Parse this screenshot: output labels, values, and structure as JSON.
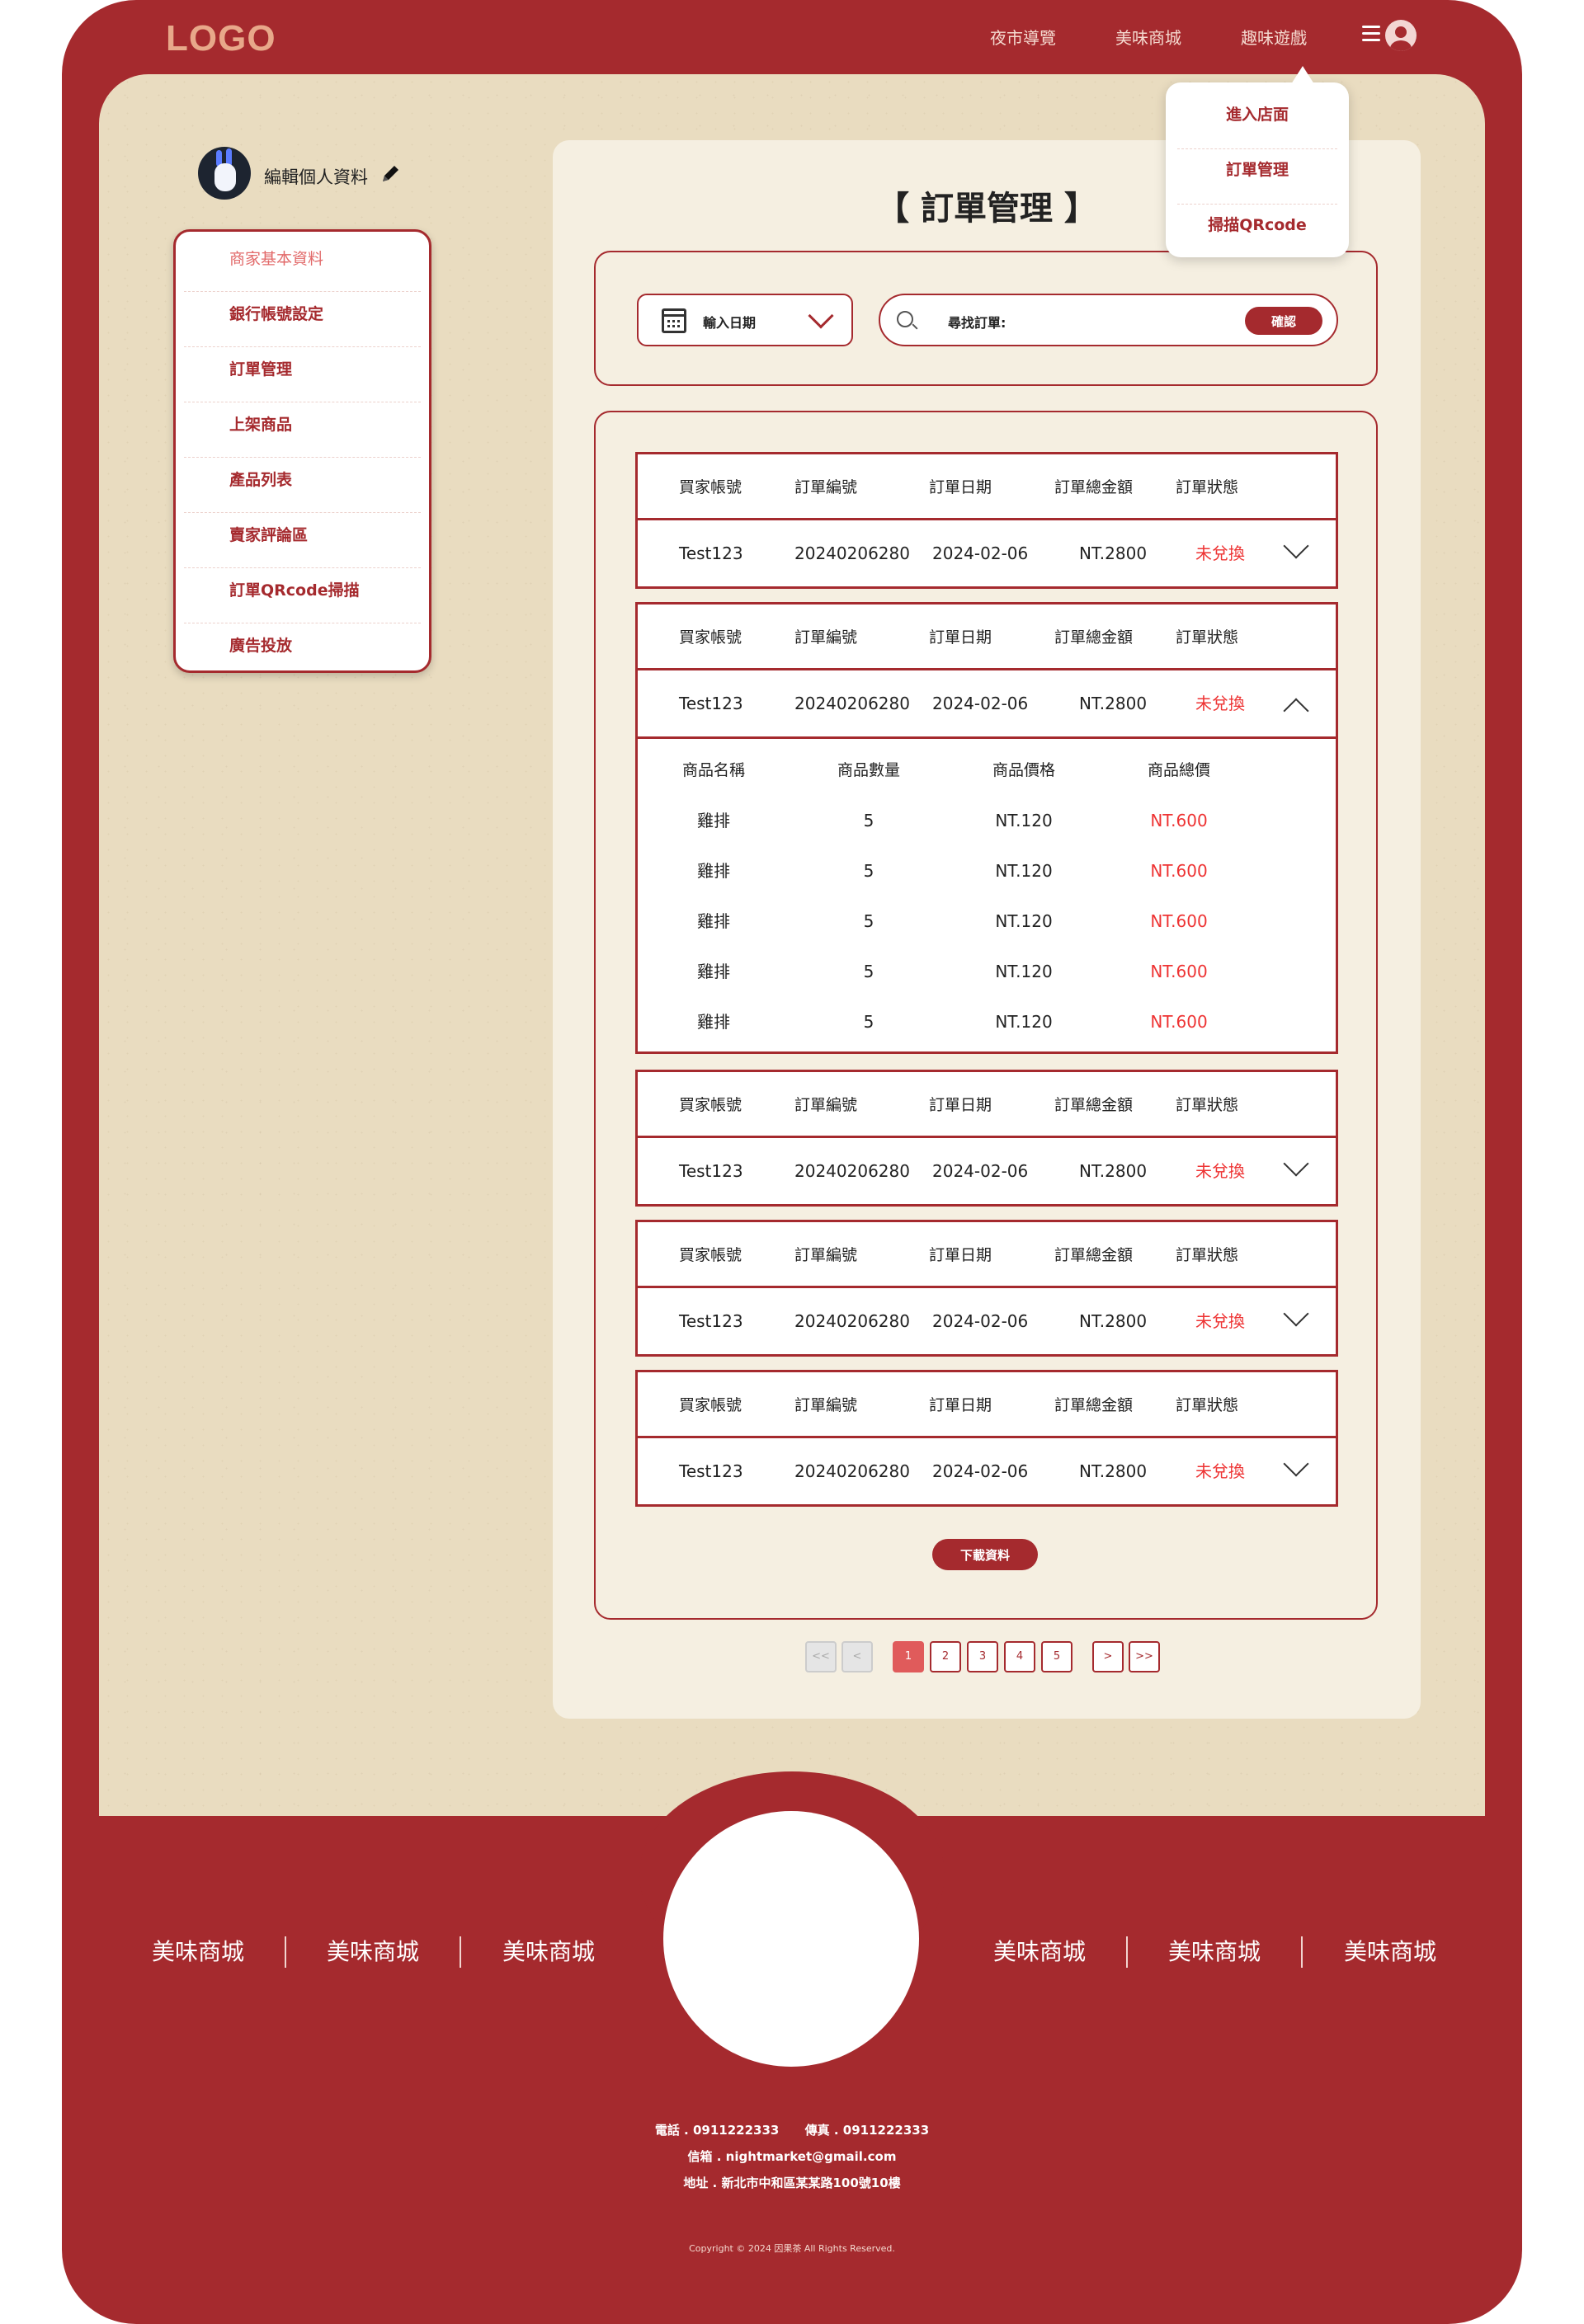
{
  "header": {
    "logo": "LOGO",
    "nav": [
      "夜市導覽",
      "美味商城",
      "趣味遊戲"
    ]
  },
  "dropdown": [
    "進入店面",
    "訂單管理",
    "掃描QRcode"
  ],
  "profile": {
    "edit_label": "編輯個人資料"
  },
  "sidebar": [
    "商家基本資料",
    "銀行帳號設定",
    "訂單管理",
    "上架商品",
    "產品列表",
    "賣家評論區",
    "訂單QRcode掃描",
    "廣告投放"
  ],
  "main": {
    "title": "【 訂單管理 】",
    "date_label": "輸入日期",
    "search_label": "尋找訂單:",
    "search_button": "確認",
    "order_headers": [
      "買家帳號",
      "訂單編號",
      "訂單日期",
      "訂單總金額",
      "訂單狀態"
    ],
    "orders": [
      {
        "account": "Test123",
        "number": "20240206280",
        "date": "2024-02-06",
        "total": "NT.2800",
        "status": "未兌換"
      },
      {
        "account": "Test123",
        "number": "20240206280",
        "date": "2024-02-06",
        "total": "NT.2800",
        "status": "未兌換"
      },
      {
        "account": "Test123",
        "number": "20240206280",
        "date": "2024-02-06",
        "total": "NT.2800",
        "status": "未兌換"
      },
      {
        "account": "Test123",
        "number": "20240206280",
        "date": "2024-02-06",
        "total": "NT.2800",
        "status": "未兌換"
      },
      {
        "account": "Test123",
        "number": "20240206280",
        "date": "2024-02-06",
        "total": "NT.2800",
        "status": "未兌換"
      }
    ],
    "item_headers": [
      "商品名稱",
      "商品數量",
      "商品價格",
      "商品總價"
    ],
    "items": [
      {
        "name": "雞排",
        "qty": "5",
        "price": "NT.120",
        "total": "NT.600"
      },
      {
        "name": "雞排",
        "qty": "5",
        "price": "NT.120",
        "total": "NT.600"
      },
      {
        "name": "雞排",
        "qty": "5",
        "price": "NT.120",
        "total": "NT.600"
      },
      {
        "name": "雞排",
        "qty": "5",
        "price": "NT.120",
        "total": "NT.600"
      },
      {
        "name": "雞排",
        "qty": "5",
        "price": "NT.120",
        "total": "NT.600"
      }
    ],
    "download": "下載資料"
  },
  "pagination": {
    "first": "<<",
    "prev": "<",
    "pages": [
      "1",
      "2",
      "3",
      "4",
      "5"
    ],
    "next": ">",
    "last": ">>",
    "current": "1"
  },
  "footer": {
    "links": [
      "美味商城",
      "美味商城",
      "美味商城",
      "美味商城",
      "美味商城",
      "美味商城"
    ],
    "contact": "電話 . 0911222333      傳真 . 0911222333",
    "email": "信箱 . nightmarket@gmail.com",
    "address": "地址 . 新北市中和區某某路100號10樓",
    "copyright": "Copyright © 2024 因果茶 All Rights Reserved."
  },
  "colors": {
    "brand": "#a52a2e",
    "paper": "#e9dcc0",
    "status": "#e33333"
  }
}
